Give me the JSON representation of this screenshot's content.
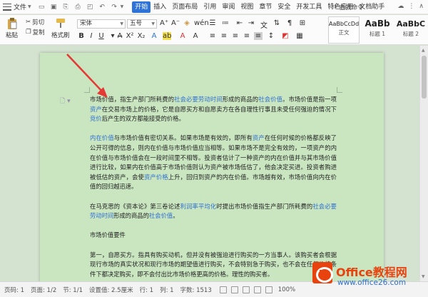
{
  "menubar": {
    "file_label": "文件",
    "tabs": [
      "开始",
      "插入",
      "页面布局",
      "引用",
      "审阅",
      "视图",
      "章节",
      "安全",
      "开发工具",
      "特色应用",
      "文档助手"
    ],
    "search_label": "查找命令"
  },
  "ribbon": {
    "paste_label": "粘贴",
    "cut_label": "剪切",
    "copy_label": "复制",
    "format_painter_label": "格式刷",
    "font_name": "宋体",
    "font_size": "五号",
    "styles": [
      {
        "sample": "AaBbCcDd",
        "name": "正文"
      },
      {
        "sample": "AaBb",
        "name": "标题 1"
      },
      {
        "sample": "AaBbC",
        "name": "标题 2"
      }
    ]
  },
  "document": {
    "p1": {
      "t1": "市场价值，指生产部门所耗费的",
      "l1": "社会必要劳动时间",
      "t2": "形成的商品的",
      "l2": "社会价值",
      "t3": "。市场价值是指一项",
      "l3": "资产",
      "t4": "在交易市场上的价格，它是自愿买方和自愿卖方在各自理性行事且未受任何强迫的情况下",
      "l4": "竞价",
      "t5": "后产生的双方都能接受的价格。"
    },
    "p2": {
      "l1": "内在价值",
      "t1": "与市场价值有密切关系。如果市场是有效的，即所有",
      "l2": "资产",
      "t2": "在任何时候的价格都反映了公开可得的信息，则内在价值与市场价值应当相等。如果市场不是完全有效的，一项资产的内在价值与市场价值会在一段时间里不相等。投资者估计了一种资产的内在价值并与其市场价值进行比较，如果内在价值高于市场价值则认为资产被市场低估了，他会决定买进。投资者购进被低估的资产，会使",
      "l3": "资产价格",
      "t3": "上升，回归到资产的内在价值。市场越有效，市场价值向内在价值的回归越迅速。"
    },
    "p3": {
      "t1": "在马克思的《资本论》第三卷论述",
      "l1": "利润率平均化",
      "t2": "时提出市场价值指生产部门所耗费的",
      "l2": "社会必要劳动时间",
      "t3": "形成的商品的",
      "l3": "社会价值",
      "t4": "。"
    },
    "p4": "市场价值要件",
    "p5": "第一，自愿买方。指具有购买动机，但并没有被强迫进行购买的一方当事人。该购买者会根据现行市场的真实状况和现行市场的期望值进行购买，不会特别急于购买，也不会在任何价格条件下都决定购买，即不会付出比市场价格更高的价格。理性的购买者。"
  },
  "statusbar": {
    "page_num": "页码: 1",
    "pages": "页面: 1/2",
    "section": "节: 1/1",
    "setting": "设置值: 2.5厘米",
    "row": "行: 1",
    "col": "列: 1",
    "wordcount": "字数: 1513",
    "zoom": "100%"
  },
  "watermark": {
    "brand_en": "Office",
    "brand_cn": "教程网",
    "url": "www.office26.com"
  },
  "colors": {
    "accent": "#2e74d8",
    "page_bg": "#c9e6c0",
    "link": "#2f6fd1",
    "arrow": "#e53935",
    "brand": "#e8430f"
  }
}
